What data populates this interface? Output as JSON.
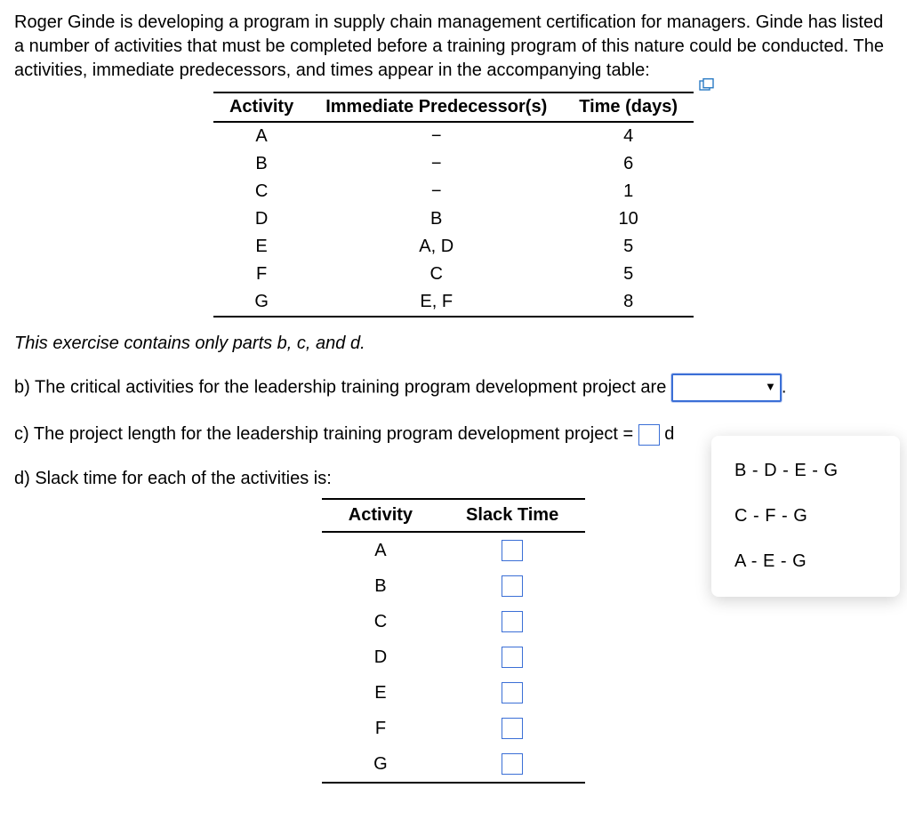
{
  "intro": "Roger Ginde is developing a program in supply chain management certification for managers. Ginde has listed a number of activities that must be completed before a training program of this nature could be conducted. The activities, immediate predecessors, and times appear in the accompanying table:",
  "main_table": {
    "headers": [
      "Activity",
      "Immediate Predecessor(s)",
      "Time (days)"
    ],
    "rows": [
      {
        "activity": "A",
        "pred": "−",
        "time": "4"
      },
      {
        "activity": "B",
        "pred": "−",
        "time": "6"
      },
      {
        "activity": "C",
        "pred": "−",
        "time": "1"
      },
      {
        "activity": "D",
        "pred": "B",
        "time": "10"
      },
      {
        "activity": "E",
        "pred": "A, D",
        "time": "5"
      },
      {
        "activity": "F",
        "pred": "C",
        "time": "5"
      },
      {
        "activity": "G",
        "pred": "E, F",
        "time": "8"
      }
    ]
  },
  "note": "This exercise contains only parts b, c, and d.",
  "part_b": "b) The critical activities for the leadership training program development project are",
  "part_b_period": ".",
  "part_c_pre": "c) The project length for the leadership training program development project =",
  "part_c_unit_cut": "d",
  "part_d": "d) Slack time for each of the activities is:",
  "slack_table": {
    "headers": [
      "Activity",
      "Slack Time"
    ],
    "rows": [
      "A",
      "B",
      "C",
      "D",
      "E",
      "F",
      "G"
    ]
  },
  "dropdown_options": [
    "B - D - E - G",
    "C - F - G",
    "A - E - G"
  ]
}
